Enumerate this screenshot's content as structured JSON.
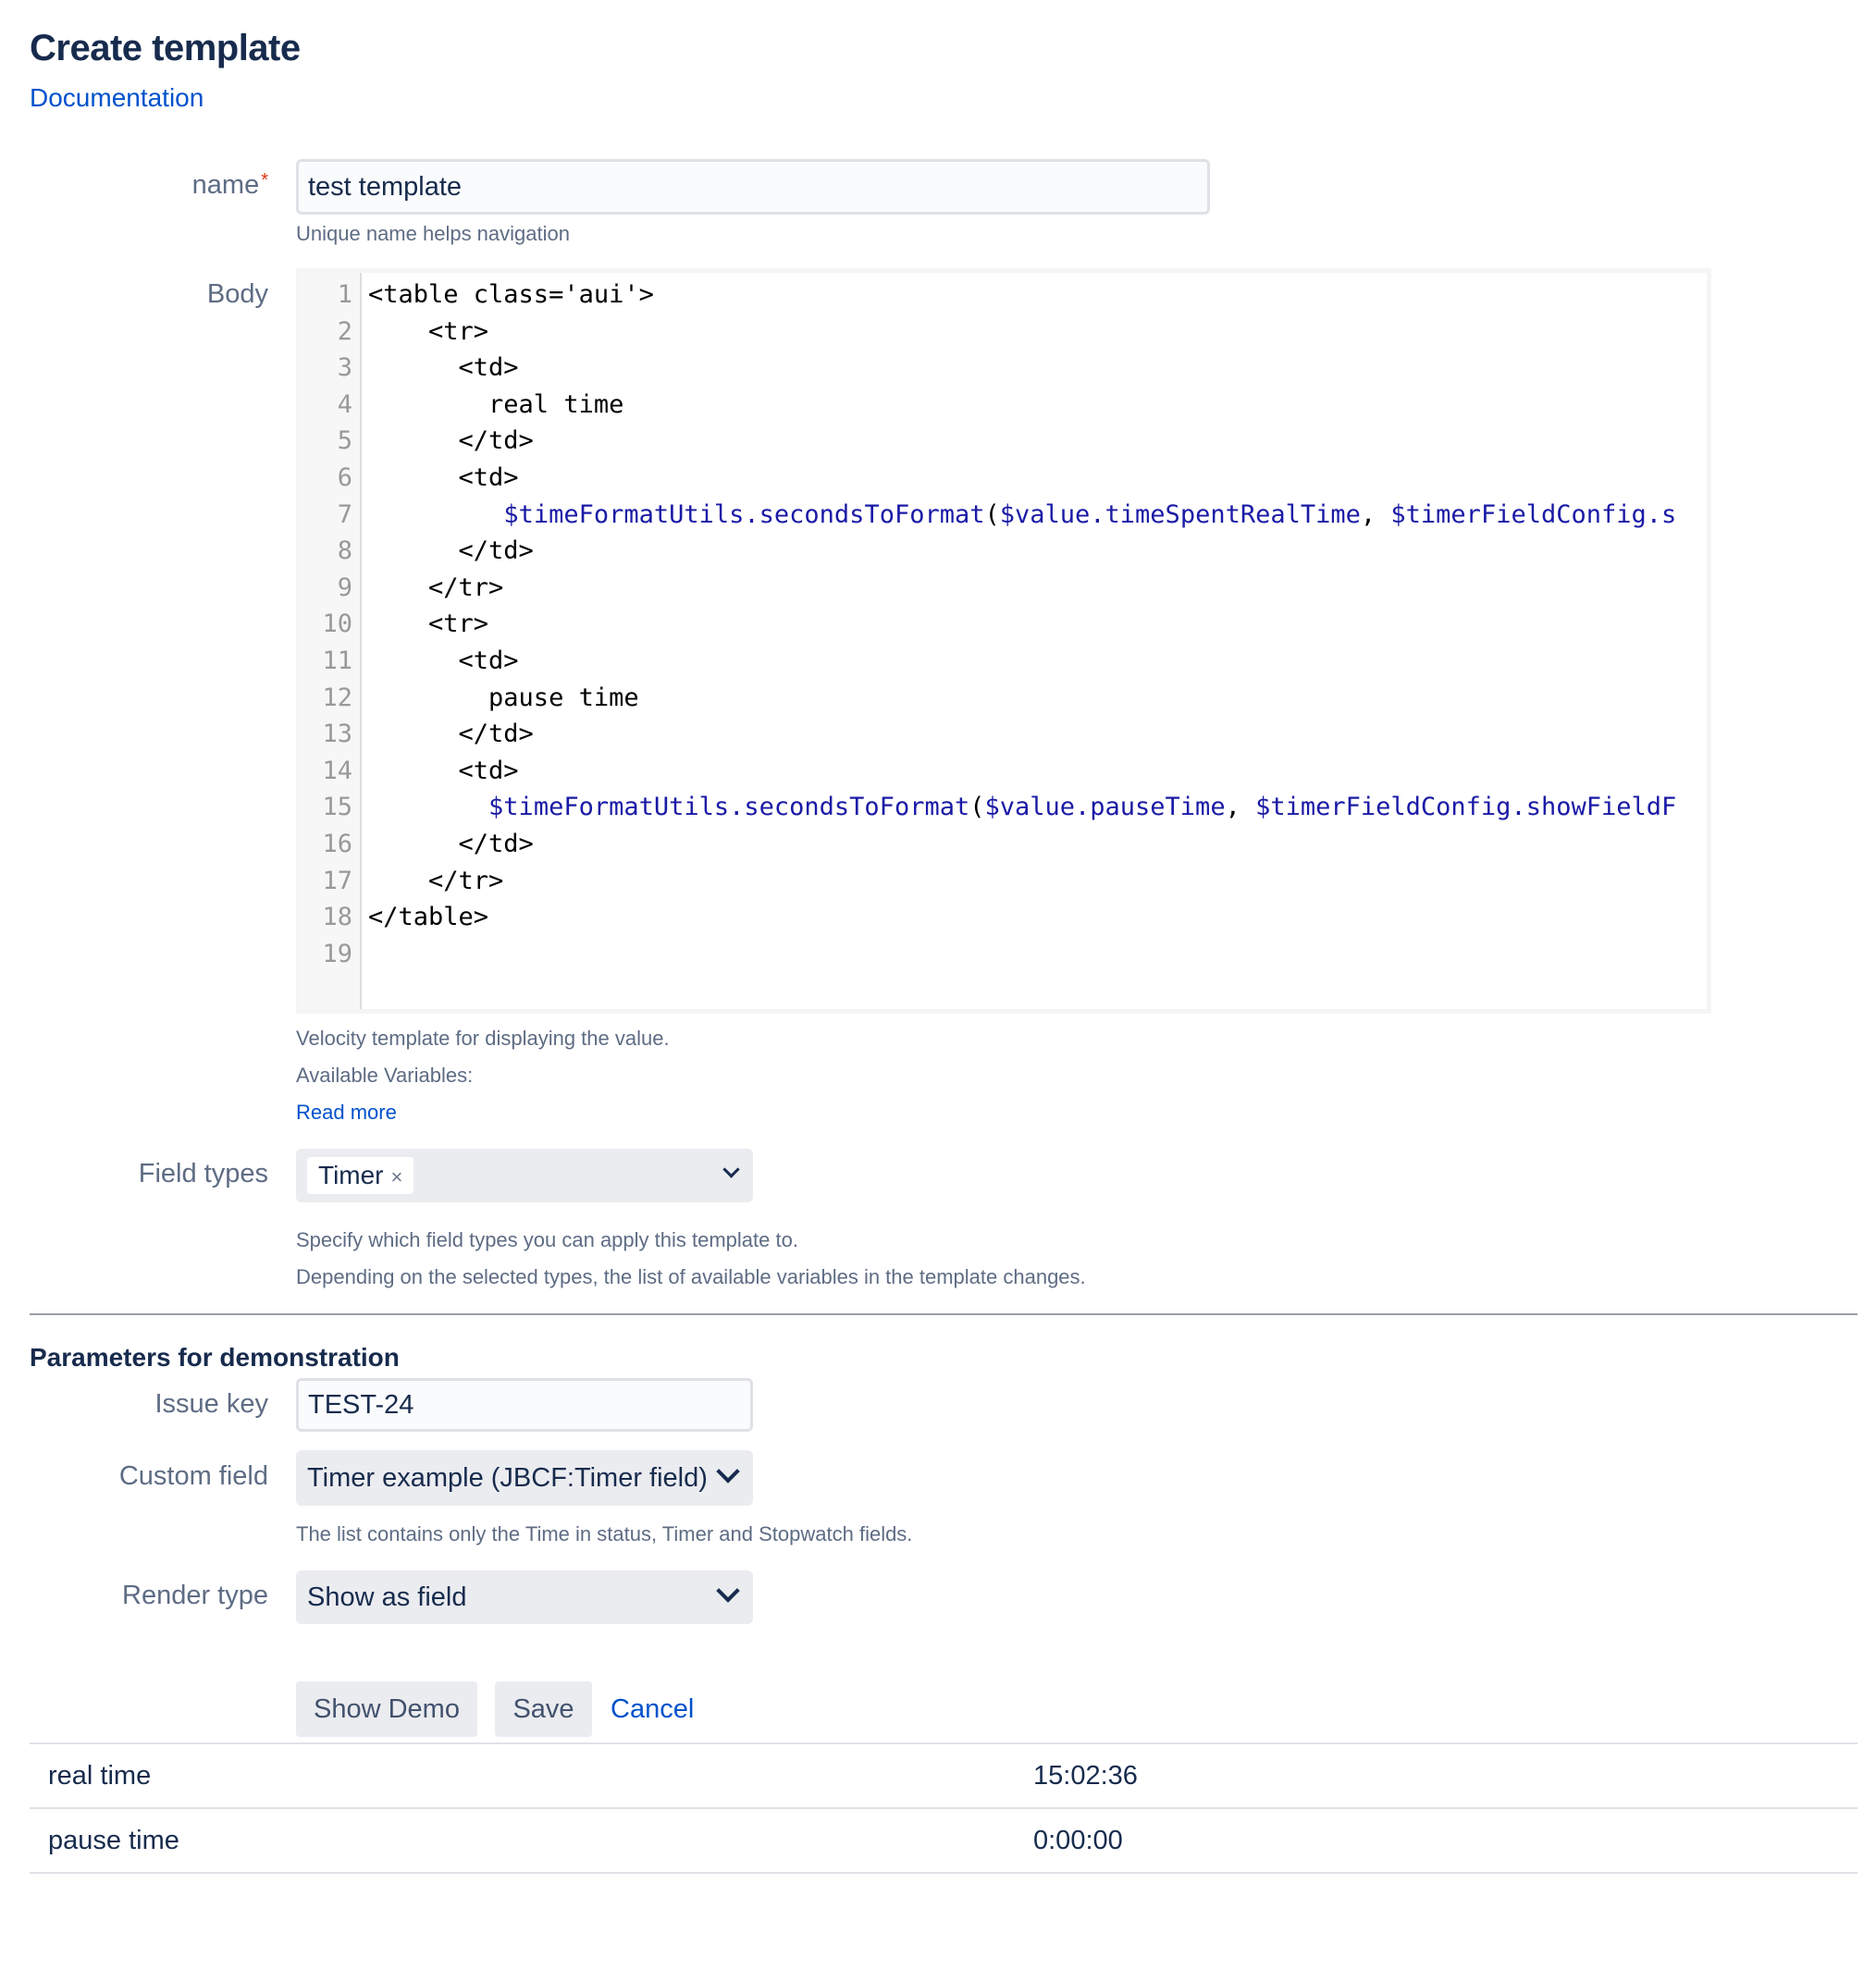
{
  "page": {
    "title": "Create template",
    "documentation_link": "Documentation"
  },
  "form": {
    "name": {
      "label": "name",
      "required_mark": "*",
      "value": "test template",
      "hint": "Unique name helps navigation"
    },
    "body": {
      "label": "Body",
      "code_lines": [
        "<table class='aui'>",
        "    <tr>",
        "      <td>",
        "        real time",
        "      </td>",
        "      <td>",
        "         $timeFormatUtils.secondsToFormat($value.timeSpentRealTime, $timerFieldConfig.s",
        "      </td>",
        "    </tr>",
        "    <tr>",
        "      <td>",
        "        pause time",
        "      </td>",
        "      <td>",
        "        $timeFormatUtils.secondsToFormat($value.pauseTime, $timerFieldConfig.showFieldF",
        "      </td>",
        "    </tr>",
        "</table>",
        ""
      ],
      "hint_1": "Velocity template for displaying the value.",
      "hint_2": "Available Variables:",
      "read_more": "Read more"
    },
    "field_types": {
      "label": "Field types",
      "selected_tag": "Timer",
      "remove_glyph": "×",
      "hint_1": "Specify which field types you can apply this template to.",
      "hint_2": "Depending on the selected types, the list of available variables in the template changes."
    }
  },
  "demo_params": {
    "section_title": "Parameters for demonstration",
    "issue_key": {
      "label": "Issue key",
      "value": "TEST-24"
    },
    "custom_field": {
      "label": "Custom field",
      "selected": "Timer example (JBCF:Timer field)",
      "hint": "The list contains only the Time in status, Timer and Stopwatch fields."
    },
    "render_type": {
      "label": "Render type",
      "selected": "Show as field"
    }
  },
  "actions": {
    "show_demo": "Show Demo",
    "save": "Save",
    "cancel": "Cancel"
  },
  "result_rows": [
    {
      "label": "real time",
      "value": "15:02:36"
    },
    {
      "label": "pause time",
      "value": "0:00:00"
    }
  ],
  "colors": {
    "link": "#0052cc",
    "required": "#de350b",
    "code_variable": "#1a1aa6"
  }
}
